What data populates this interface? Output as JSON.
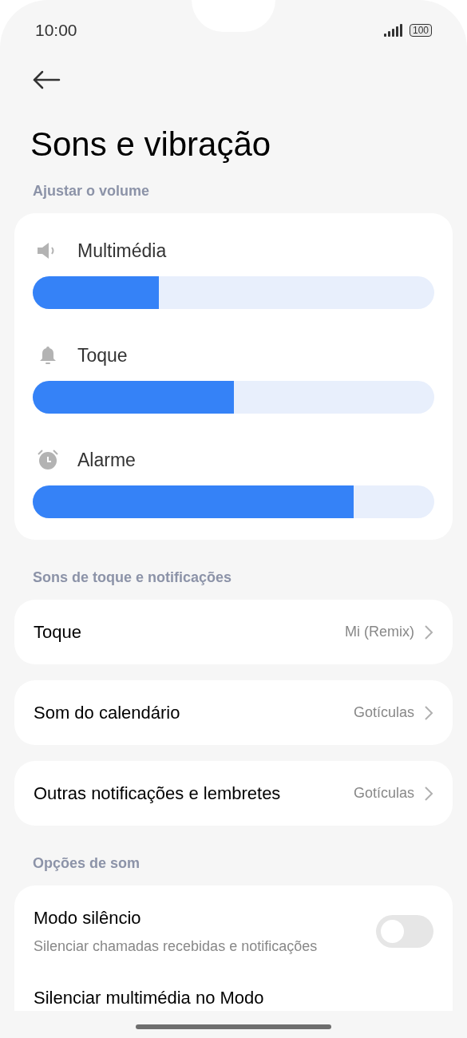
{
  "status_bar": {
    "time": "10:00",
    "battery": "100"
  },
  "title": "Sons e vibração",
  "volume_section": {
    "heading": "Ajustar o volume",
    "sliders": [
      {
        "kind": "speaker",
        "label": "Multimédia",
        "level": 0.315
      },
      {
        "kind": "bell",
        "label": "Toque",
        "level": 0.5
      },
      {
        "kind": "alarm",
        "label": "Alarme",
        "level": 0.8
      }
    ]
  },
  "tones_section": {
    "heading": "Sons de toque e notificações",
    "items": [
      {
        "label": "Toque",
        "value": "Mi (Remix)"
      },
      {
        "label": "Som do calendário",
        "value": "Gotículas"
      },
      {
        "label": "Outras notificações e lembretes",
        "value": "Gotículas"
      }
    ]
  },
  "options_section": {
    "heading": "Opções de som",
    "items": [
      {
        "label": "Modo silêncio",
        "description": "Silenciar chamadas recebidas e notificações",
        "on": false
      },
      {
        "label": "Silenciar multimédia no Modo"
      }
    ]
  }
}
